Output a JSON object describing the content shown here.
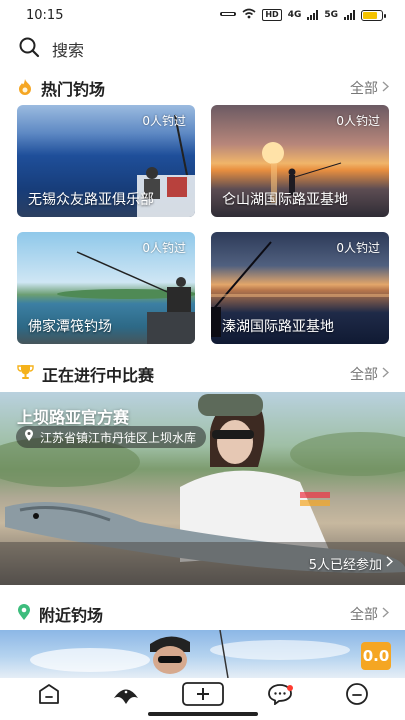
{
  "status_bar": {
    "time": "10:15",
    "network": "HD",
    "signal1": "4G",
    "signal2": "5G",
    "battery_level": 0.8
  },
  "search": {
    "placeholder": "搜索"
  },
  "hot_spots": {
    "title": "热门钓场",
    "more": "全部",
    "cards": [
      {
        "name": "无锡众友路亚俱乐部",
        "count": "0人钓过"
      },
      {
        "name": "仑山湖国际路亚基地",
        "count": "0人钓过"
      },
      {
        "name": "佛家潭筏钓场",
        "count": "0人钓过"
      },
      {
        "name": "溱湖国际路亚基地",
        "count": "0人钓过"
      }
    ]
  },
  "ongoing_matches": {
    "title": "正在进行中比赛",
    "more": "全部",
    "match": {
      "title": "上坝路亚官方赛",
      "location": "江苏省镇江市丹徒区上坝水库",
      "joined": "5人已经参加"
    }
  },
  "nearby": {
    "title": "附近钓场",
    "more": "全部",
    "score": "0.0"
  },
  "colors": {
    "accent": "#f5a623",
    "text": "#222222",
    "muted": "#777777",
    "badge_dot": "#ff3b30"
  },
  "icons": {
    "search": "search-icon",
    "hot": "flame-icon",
    "match": "trophy-icon",
    "nearby": "location-pin-icon",
    "tabs": [
      "home-icon",
      "fish-icon",
      "plus-icon",
      "message-icon",
      "profile-icon"
    ]
  }
}
